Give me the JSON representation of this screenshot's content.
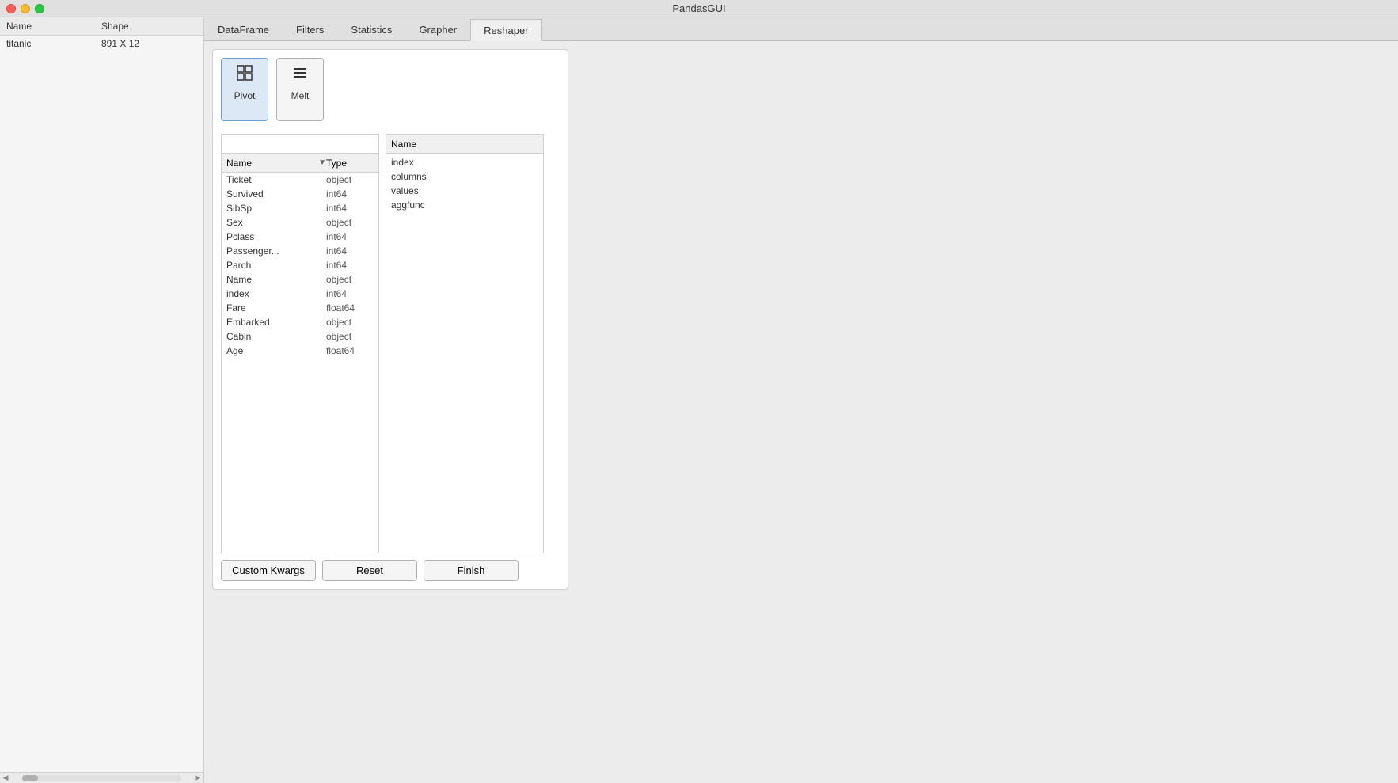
{
  "app": {
    "title": "PandasGUI"
  },
  "traffic_lights": {
    "close": "close",
    "minimize": "minimize",
    "maximize": "maximize"
  },
  "sidebar": {
    "col_name": "Name",
    "col_shape": "Shape",
    "rows": [
      {
        "name": "titanic",
        "shape": "891 X 12"
      }
    ]
  },
  "tabs": [
    {
      "id": "dataframe",
      "label": "DataFrame"
    },
    {
      "id": "filters",
      "label": "Filters"
    },
    {
      "id": "statistics",
      "label": "Statistics"
    },
    {
      "id": "grapher",
      "label": "Grapher"
    },
    {
      "id": "reshaper",
      "label": "Reshaper"
    }
  ],
  "active_tab": "reshaper",
  "reshaper": {
    "operations": [
      {
        "id": "pivot",
        "icon": "⊞",
        "label": "Pivot",
        "selected": true
      },
      {
        "id": "melt",
        "icon": "≡",
        "label": "Melt",
        "selected": false
      }
    ],
    "column_list": {
      "search_placeholder": "",
      "header_name": "Name",
      "header_type": "Type",
      "columns": [
        {
          "name": "Ticket",
          "type": "object"
        },
        {
          "name": "Survived",
          "type": "int64"
        },
        {
          "name": "SibSp",
          "type": "int64"
        },
        {
          "name": "Sex",
          "type": "object"
        },
        {
          "name": "Pclass",
          "type": "int64"
        },
        {
          "name": "Passenger...",
          "type": "int64"
        },
        {
          "name": "Parch",
          "type": "int64"
        },
        {
          "name": "Name",
          "type": "object"
        },
        {
          "name": "index",
          "type": "int64"
        },
        {
          "name": "Fare",
          "type": "float64"
        },
        {
          "name": "Embarked",
          "type": "object"
        },
        {
          "name": "Cabin",
          "type": "object"
        },
        {
          "name": "Age",
          "type": "float64"
        }
      ]
    },
    "name_list": {
      "header": "Name",
      "items": [
        "index",
        "columns",
        "values",
        "aggfunc"
      ]
    },
    "buttons": {
      "custom_kwargs": "Custom Kwargs",
      "reset": "Reset",
      "finish": "Finish"
    }
  }
}
